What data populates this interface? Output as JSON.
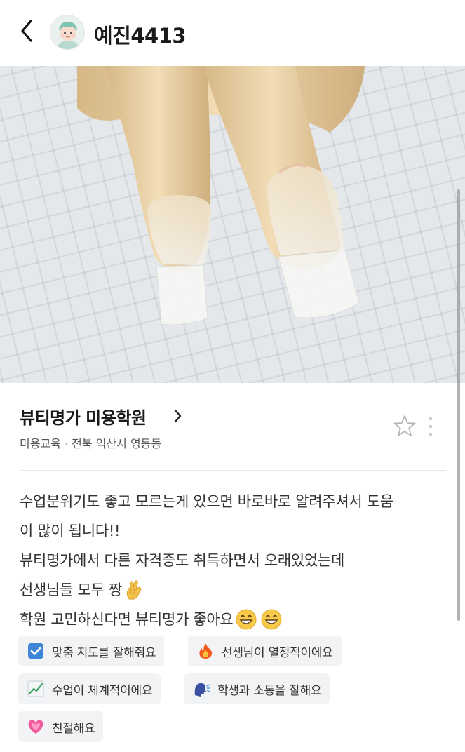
{
  "header": {
    "username": "예진4413",
    "back_icon": "chevron-left-icon",
    "avatar_icon": "profile-avatar"
  },
  "place": {
    "name": "뷰티명가 미용학원",
    "category": "미용교육",
    "separator": "·",
    "location": "전북 익산시 영등동"
  },
  "review": {
    "lines": [
      "수업분위기도 좋고 모르는게 있으면 바로바로 알려주셔서 도움",
      "이 많이 됩니다!!",
      "뷰티명가에서 다른 자격증도 취득하면서 오래있었는데",
      "선생님들 모두 짱",
      "학원 고민하신다면 뷰티명가 좋아요"
    ]
  },
  "tags": [
    {
      "label": "맞춤 지도를 잘해줘요",
      "icon": "check-box-icon"
    },
    {
      "label": "선생님이 열정적이에요",
      "icon": "fire-icon"
    },
    {
      "label": "수업이 체계적이에요",
      "icon": "chart-up-icon"
    },
    {
      "label": "학생과 소통을 잘해요",
      "icon": "speaking-head-icon"
    },
    {
      "label": "친절해요",
      "icon": "heart-icon"
    }
  ],
  "colors": {
    "text": "#222222",
    "meta": "#555555",
    "chip_bg": "#f2f3f5",
    "star": "#b5b5b5"
  }
}
